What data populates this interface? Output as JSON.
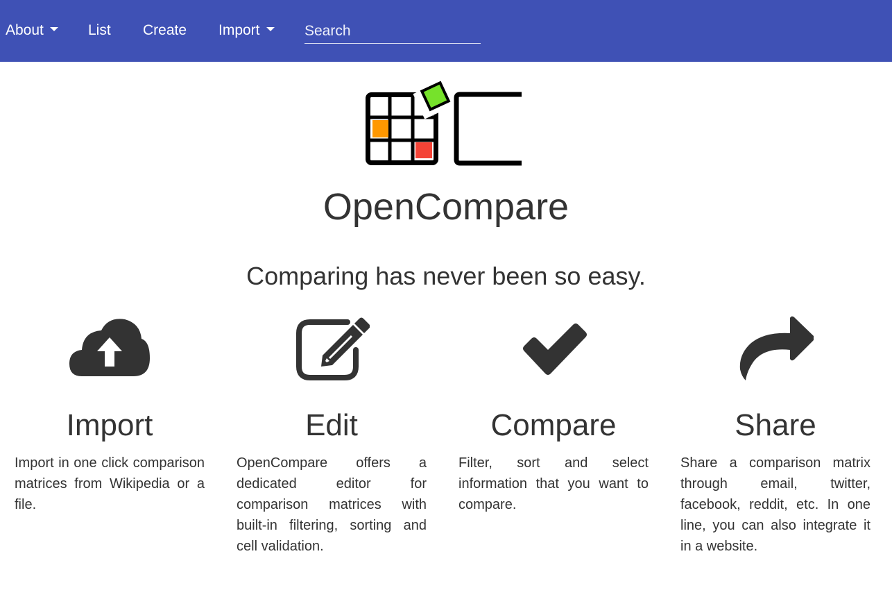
{
  "nav": {
    "about": "About",
    "list": "List",
    "create": "Create",
    "import": "Import",
    "search_placeholder": "Search"
  },
  "hero": {
    "title": "OpenCompare",
    "tagline": "Comparing has never been so easy."
  },
  "features": [
    {
      "icon": "cloud-upload-icon",
      "title": "Import",
      "text": "Import in one click comparison matrices from Wikipedia or a file."
    },
    {
      "icon": "edit-icon",
      "title": "Edit",
      "text": "OpenCompare offers a dedicated editor for comparison matrices with built-in filtering, sorting and cell validation."
    },
    {
      "icon": "check-icon",
      "title": "Compare",
      "text": "Filter, sort and select information that you want to compare."
    },
    {
      "icon": "share-icon",
      "title": "Share",
      "text": "Share a comparison matrix through email, twitter, facebook, reddit, etc. In one line, you can also integrate it in a website."
    }
  ],
  "colors": {
    "navbar": "#3f51b5",
    "text": "#333333",
    "logo_green": "#76e22b",
    "logo_orange": "#ff9800",
    "logo_red": "#f44336"
  }
}
